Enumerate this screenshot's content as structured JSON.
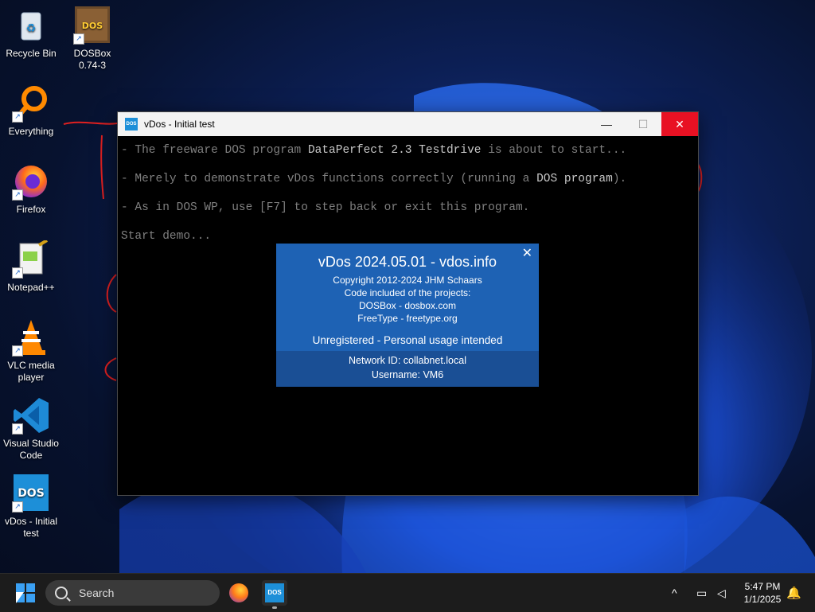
{
  "desktop": {
    "icons": [
      {
        "label": "Recycle Bin"
      },
      {
        "label": "DOSBox\n0.74-3",
        "glyph": "DOSBOX"
      },
      {
        "label": "Everything"
      },
      {
        "label": "Firefox"
      },
      {
        "label": "Notepad++"
      },
      {
        "label": "VLC media\nplayer"
      },
      {
        "label": "Visual Studio\nCode"
      },
      {
        "label": "vDos - Initial\ntest",
        "glyph": "DOS"
      }
    ]
  },
  "window": {
    "title": "vDos - Initial test",
    "icon_text": "DOS",
    "controls": {
      "minimize": "—",
      "maximize": "☐",
      "close": "✕"
    },
    "console": {
      "line1_pre": "- The freeware DOS program ",
      "line1_hl": "DataPerfect 2.3 Testdrive",
      "line1_post": " is about to start...",
      "line2_pre": "- Merely to demonstrate vDos functions correctly (running a ",
      "line2_hl": "DOS program",
      "line2_post": ").",
      "line3": "- As in DOS WP, use [F7] to step back or exit this program.",
      "line4": "Start demo..."
    }
  },
  "about": {
    "title": "vDos 2024.05.01  -  vdos.info",
    "copyright": "Copyright 2012-2024 JHM Schaars",
    "included": "Code included of the projects:",
    "project1": "DOSBox  - dosbox.com",
    "project2": "FreeType - freetype.org",
    "registration": "Unregistered  -  Personal usage intended",
    "network": "Network ID: collabnet.local",
    "username": "Username: VM6",
    "close": "✕"
  },
  "taskbar": {
    "search_label": "Search",
    "dos_text": "DOS",
    "time": "5:47 PM",
    "date": "1/1/2025",
    "tray_chevron": "^",
    "tray_network": "▭",
    "tray_volume": "◁",
    "tray_bell": "🔔"
  },
  "colors": {
    "accent": "#1e62b4",
    "close_red": "#e81123",
    "start_blue": "#3aa0f3"
  }
}
